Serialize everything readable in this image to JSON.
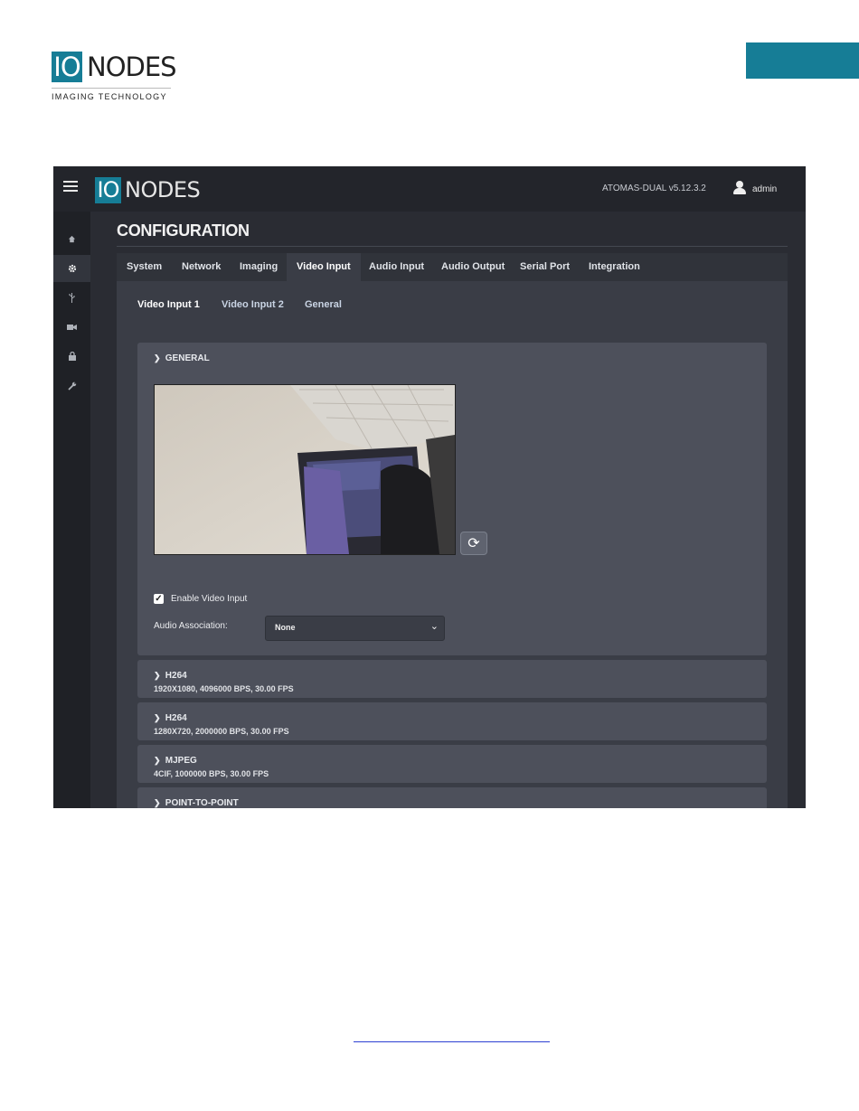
{
  "document": {
    "logo": {
      "io": "IO",
      "nodes": "NODES",
      "tagline": "IMAGING TECHNOLOGY"
    }
  },
  "app": {
    "logo": {
      "io": "IO",
      "nodes": "NODES"
    },
    "device": "ATOMAS-DUAL   v5.12.3.2",
    "user": "admin",
    "icons": {
      "menu": "hamburger-icon",
      "user": "user-icon",
      "sidebar": [
        "home-icon",
        "gear-icon",
        "usb-icon",
        "camera-icon",
        "lock-icon",
        "wrench-icon"
      ]
    },
    "page_title": "CONFIGURATION",
    "tabs": [
      {
        "label": "System"
      },
      {
        "label": "Network"
      },
      {
        "label": "Imaging"
      },
      {
        "label": "Video Input",
        "active": true
      },
      {
        "label": "Audio Input"
      },
      {
        "label": "Audio Output"
      },
      {
        "label": "Serial Port"
      },
      {
        "label": "Integration"
      }
    ],
    "subtabs": [
      {
        "label": "Video Input 1",
        "active": true
      },
      {
        "label": "Video Input 2"
      },
      {
        "label": "General"
      }
    ],
    "general": {
      "title": "GENERAL",
      "enable_label": "Enable Video Input",
      "enable_checked": true,
      "audio_assoc_label": "Audio Association:",
      "audio_assoc_value": "None"
    },
    "streams": [
      {
        "title": "H264",
        "details": "1920X1080, 4096000 BPS, 30.00 FPS"
      },
      {
        "title": "H264",
        "details": "1280X720, 2000000 BPS, 30.00 FPS"
      },
      {
        "title": "MJPEG",
        "details": "4CIF, 1000000 BPS, 30.00 FPS"
      },
      {
        "title": "POINT-TO-POINT",
        "details": ""
      }
    ],
    "colors": {
      "accent": "#167d96",
      "background": "#2a2c33",
      "panel": "#4d505b"
    }
  }
}
